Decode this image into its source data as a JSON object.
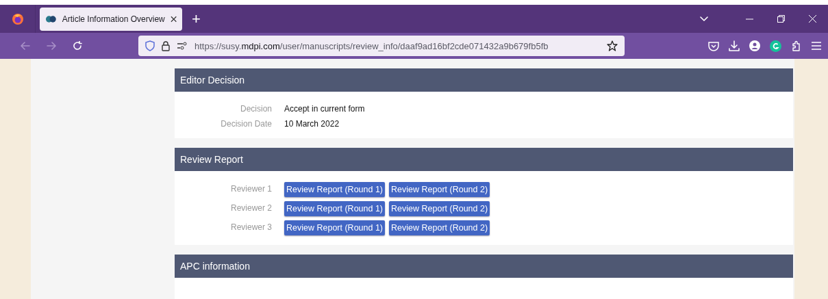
{
  "browser": {
    "tab": {
      "title": "Article Information Overview",
      "selected": true
    },
    "new_tab": "+",
    "url": "https://susy.**mdpi.com**/user/manuscripts/review_info/daaf9ad16bf2cde071432a9b679fb5fb"
  },
  "sections": [
    {
      "kind": "fields",
      "title": "Editor Decision",
      "fields": [
        {
          "label": "Decision",
          "value": "Accept in current form"
        },
        {
          "label": "Decision Date",
          "value": "10 March 2022"
        }
      ]
    },
    {
      "kind": "reviewers",
      "title": "Review Report",
      "reviewers": [
        {
          "label": "Reviewer 1",
          "reports": [
            "Review Report (Round 1)",
            "Review Report (Round 2)"
          ]
        },
        {
          "label": "Reviewer 2",
          "reports": [
            "Review Report (Round 1)",
            "Review Report (Round 2)"
          ]
        },
        {
          "label": "Reviewer 3",
          "reports": [
            "Review Report (Round 1)",
            "Review Report (Round 2)"
          ]
        }
      ]
    },
    {
      "kind": "empty",
      "title": "APC information"
    }
  ]
}
